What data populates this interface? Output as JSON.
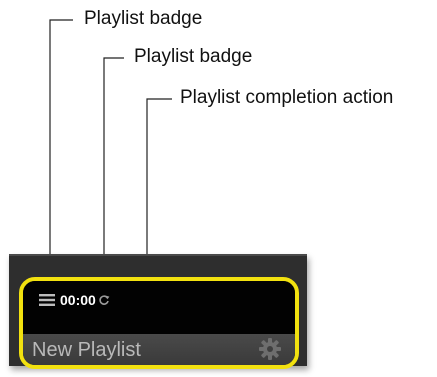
{
  "callouts": {
    "list_badge_label": "Playlist badge",
    "duration_badge_label": "Playlist badge",
    "completion_action_label": "Playlist completion action"
  },
  "playlist_tile": {
    "duration": "00:00",
    "name": "New Playlist",
    "selected_border_color": "#f2e10f",
    "list_icon": "list-icon",
    "completion_icon": "repeat-icon",
    "settings_icon": "gear-icon"
  }
}
